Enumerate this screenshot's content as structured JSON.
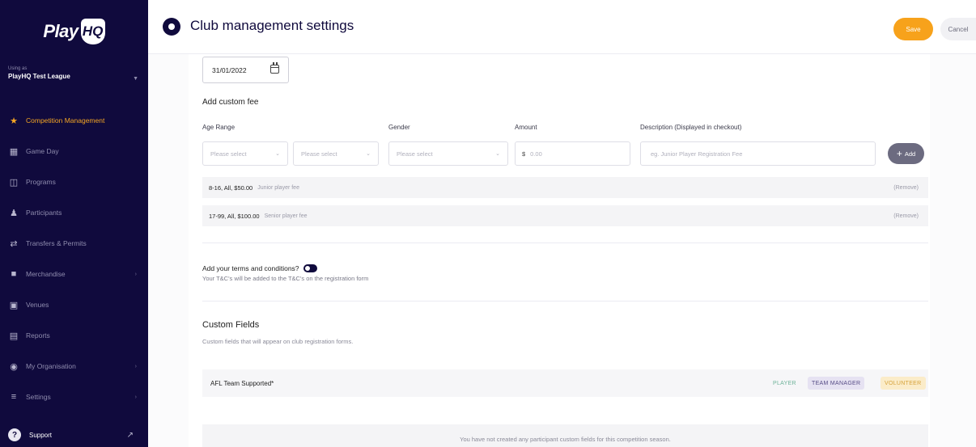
{
  "brand": {
    "logo_text": "Play",
    "logo_badge": "HQ"
  },
  "org": {
    "caption": "Using as",
    "name": "PlayHQ Test League"
  },
  "sidebar": {
    "items": [
      {
        "label": "Competition Management",
        "icon": "trophy-icon",
        "active": true,
        "chevron": false
      },
      {
        "label": "Game Day",
        "icon": "scoreboard-icon",
        "active": false,
        "chevron": false
      },
      {
        "label": "Programs",
        "icon": "book-icon",
        "active": false,
        "chevron": false
      },
      {
        "label": "Participants",
        "icon": "people-icon",
        "active": false,
        "chevron": false
      },
      {
        "label": "Transfers & Permits",
        "icon": "arrows-icon",
        "active": false,
        "chevron": false
      },
      {
        "label": "Merchandise",
        "icon": "shirt-icon",
        "active": false,
        "chevron": true
      },
      {
        "label": "Venues",
        "icon": "venue-icon",
        "active": false,
        "chevron": false
      },
      {
        "label": "Reports",
        "icon": "reports-icon",
        "active": false,
        "chevron": false
      },
      {
        "label": "My Organisation",
        "icon": "globe-icon",
        "active": false,
        "chevron": true
      },
      {
        "label": "Settings",
        "icon": "sliders-icon",
        "active": false,
        "chevron": true
      }
    ],
    "support_label": "Support"
  },
  "header": {
    "title": "Club management settings",
    "save_label": "Save",
    "cancel_label": "Cancel"
  },
  "form": {
    "date_value": "31/01/2022",
    "custom_fee": {
      "title": "Add custom fee",
      "columns": {
        "age_range": "Age Range",
        "gender": "Gender",
        "amount": "Amount",
        "description": "Description (Displayed in checkout)"
      },
      "age_from_placeholder": "Please select",
      "age_to_placeholder": "Please select",
      "gender_placeholder": "Please select",
      "amount_currency": "$",
      "amount_placeholder": "0.00",
      "description_placeholder": "eg. Junior Player Registration Fee",
      "add_label": "Add"
    },
    "fees": [
      {
        "summary": "8-16, All, $50.00",
        "description": "Junior player fee",
        "remove_label": "(Remove)"
      },
      {
        "summary": "17-99, All, $100.00",
        "description": "Senior player fee",
        "remove_label": "(Remove)"
      }
    ],
    "terms": {
      "title": "Add your terms and conditions?",
      "subtitle": "Your T&C's will be added to the T&C's on the registration form",
      "enabled": false
    },
    "custom_fields": {
      "title": "Custom Fields",
      "subtitle": "Custom fields that will appear on club registration forms.",
      "rows": [
        {
          "label": "AFL Team Supported*",
          "tags": [
            "PLAYER",
            "TEAM MANAGER",
            "VOLUNTEER"
          ]
        }
      ],
      "empty_message": "You have not created any participant custom fields for this competition season."
    }
  },
  "colors": {
    "sidebar_bg": "#100a3d",
    "accent": "#f7a21b",
    "active_nav": "#f5a623"
  }
}
